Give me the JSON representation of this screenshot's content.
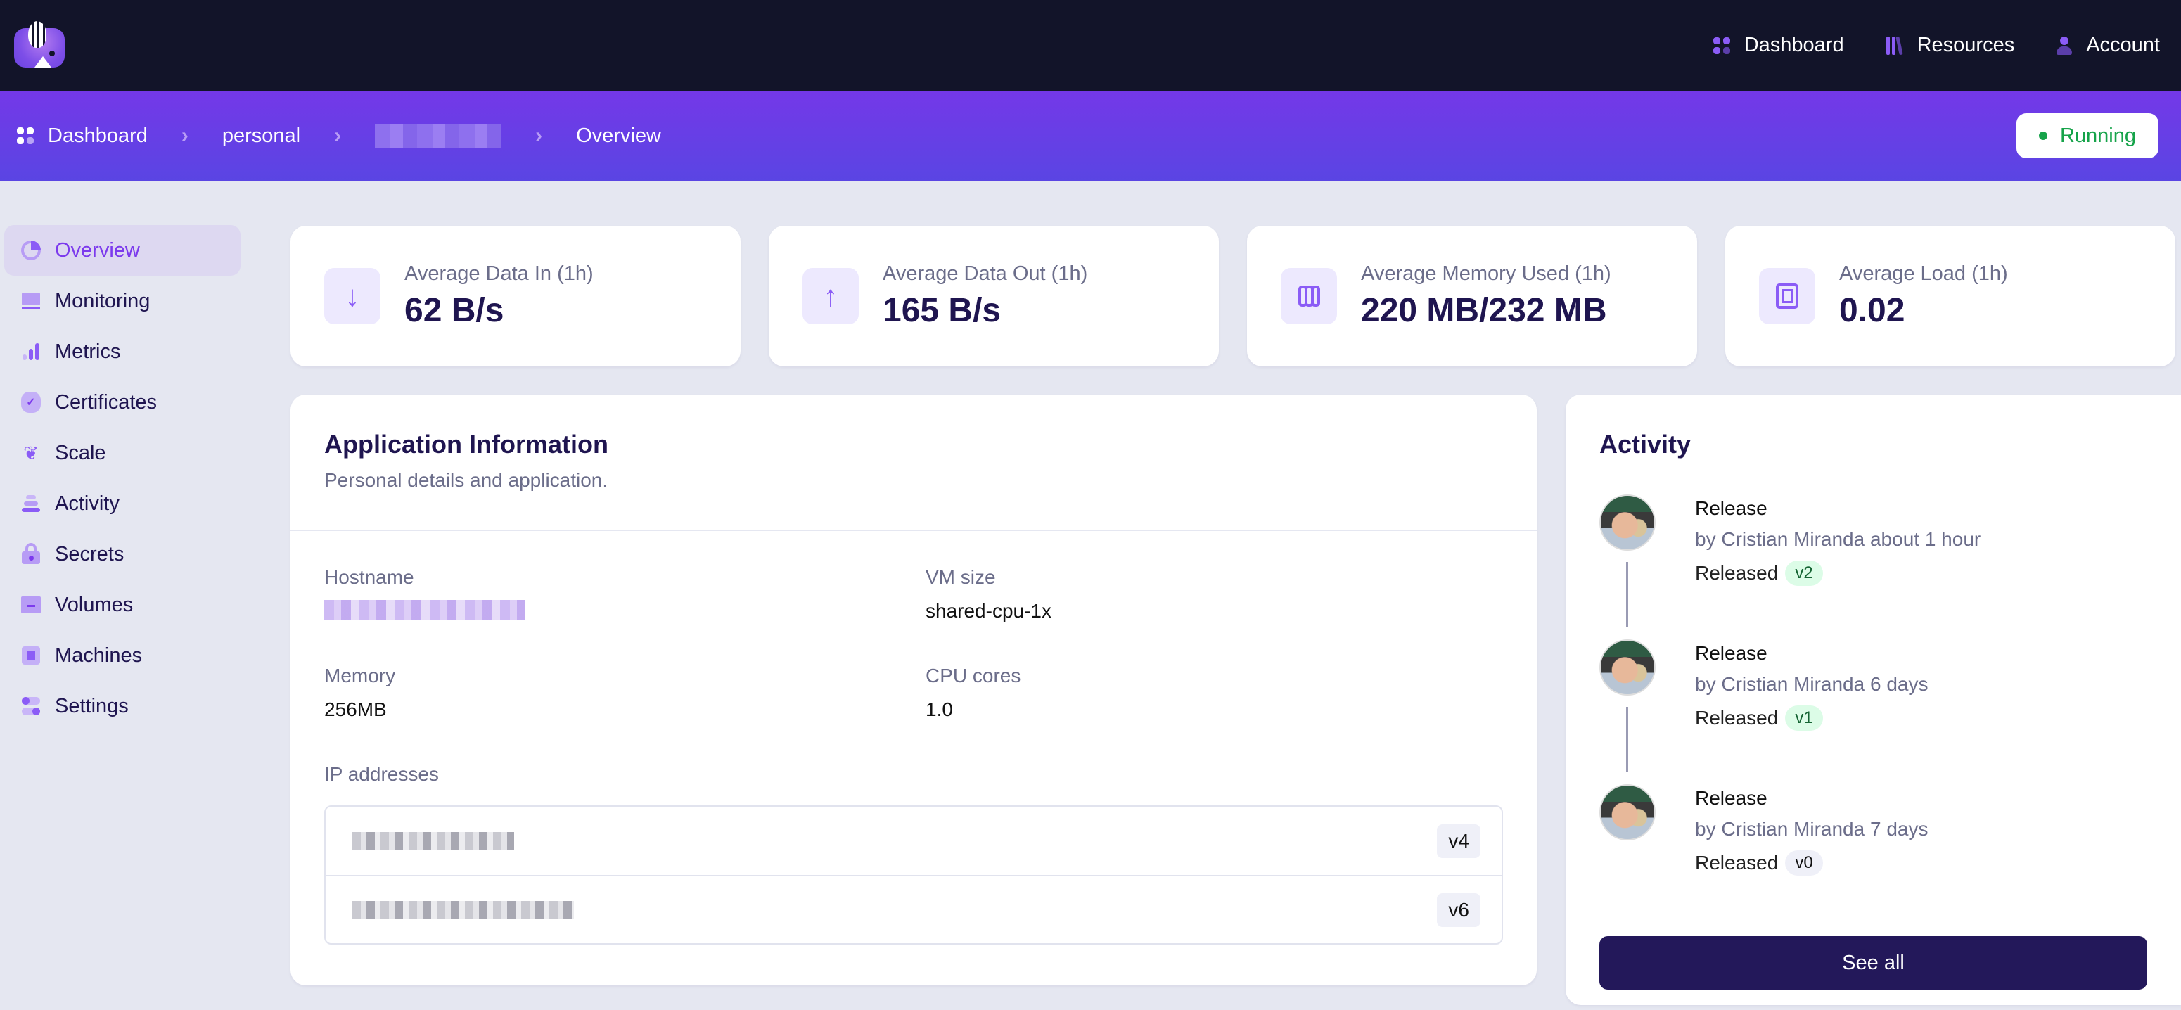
{
  "topnav": {
    "links": [
      {
        "label": "Dashboard",
        "icon": "grid-icon"
      },
      {
        "label": "Resources",
        "icon": "books-icon"
      },
      {
        "label": "Account",
        "icon": "user-icon"
      }
    ]
  },
  "breadcrumb": {
    "items": [
      "Dashboard",
      "personal",
      "[redacted app name]",
      "Overview"
    ]
  },
  "status": {
    "label": "Running",
    "color": "#16a34a"
  },
  "sidebar": {
    "items": [
      {
        "label": "Overview",
        "active": true
      },
      {
        "label": "Monitoring"
      },
      {
        "label": "Metrics"
      },
      {
        "label": "Certificates"
      },
      {
        "label": "Scale"
      },
      {
        "label": "Activity"
      },
      {
        "label": "Secrets"
      },
      {
        "label": "Volumes"
      },
      {
        "label": "Machines"
      },
      {
        "label": "Settings"
      }
    ]
  },
  "stats": [
    {
      "label": "Average Data In (1h)",
      "value": "62 B/s",
      "icon": "arrow-down-icon"
    },
    {
      "label": "Average Data Out (1h)",
      "value": "165 B/s",
      "icon": "arrow-up-icon"
    },
    {
      "label": "Average Memory Used (1h)",
      "value": "220 MB/232 MB",
      "icon": "memory-icon"
    },
    {
      "label": "Average Load (1h)",
      "value": "0.02",
      "icon": "cpu-icon"
    }
  ],
  "app_info": {
    "title": "Application Information",
    "subtitle": "Personal details and application.",
    "fields": {
      "hostname": {
        "label": "Hostname",
        "value": "[redacted]"
      },
      "vm_size": {
        "label": "VM size",
        "value": "shared-cpu-1x"
      },
      "memory": {
        "label": "Memory",
        "value": "256MB"
      },
      "cpu_cores": {
        "label": "CPU cores",
        "value": "1.0"
      }
    },
    "ip_label": "IP addresses",
    "ips": [
      {
        "address": "[redacted]",
        "version": "v4"
      },
      {
        "address": "[redacted]",
        "version": "v6"
      }
    ]
  },
  "activity": {
    "title": "Activity",
    "items": [
      {
        "title": "Release",
        "by": "by Cristian Miranda about 1 hour",
        "released_label": "Released",
        "version": "v2",
        "badge": "green"
      },
      {
        "title": "Release",
        "by": "by Cristian Miranda 6 days",
        "released_label": "Released",
        "version": "v1",
        "badge": "green"
      },
      {
        "title": "Release",
        "by": "by Cristian Miranda 7 days",
        "released_label": "Released",
        "version": "v0",
        "badge": "gray"
      }
    ],
    "see_all_label": "See all"
  },
  "colors": {
    "nav_bg": "#121429",
    "accent": "#7c3aed",
    "button_dark": "#23185a"
  }
}
